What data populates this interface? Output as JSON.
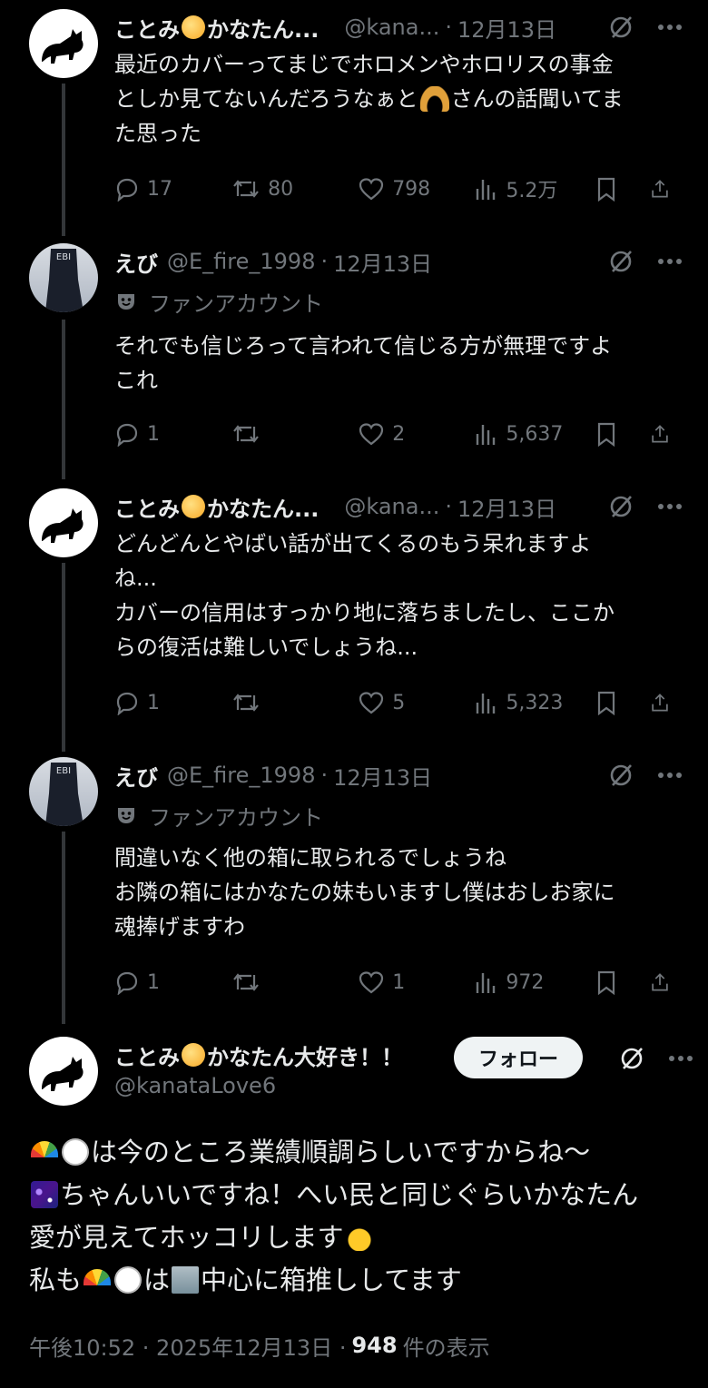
{
  "replies": [
    {
      "name": "ことみ",
      "name_after_emoji": "かなたん...",
      "handle": "@kana...",
      "dot": "·",
      "date": "12月13日",
      "text": "最近のカバーってまじでホロメンやホロリスの事金\nとしか見てないんだろうなぁと",
      "text_after_emoji": "さんの話聞いてま\nた思った",
      "reply_count": "17",
      "repost_count": "80",
      "like_count": "798",
      "view_count": "5.2万"
    },
    {
      "name": "えび",
      "handle": "@E_fire_1998",
      "dot": "·",
      "date": "12月13日",
      "label": "ファンアカウント",
      "text": "それでも信じろって言われて信じる方が無理ですよ\nこれ",
      "reply_count": "1",
      "repost_count": "",
      "like_count": "2",
      "view_count": "5,637"
    },
    {
      "name": "ことみ",
      "name_after_emoji": "かなたん...",
      "handle": "@kana...",
      "dot": "·",
      "date": "12月13日",
      "text": "どんどんとやばい話が出てくるのもう呆れますよ\nね...\nカバーの信用はすっかり地に落ちましたし、ここか\nらの復活は難しいでしょうね...",
      "reply_count": "1",
      "repost_count": "",
      "like_count": "5",
      "view_count": "5,323"
    },
    {
      "name": "えび",
      "handle": "@E_fire_1998",
      "dot": "·",
      "date": "12月13日",
      "label": "ファンアカウント",
      "text": "間違いなく他の箱に取られるでしょうね\nお隣の箱にはかなたの妹もいますし僕はおしお家に\n魂捧げますわ",
      "reply_count": "1",
      "repost_count": "",
      "like_count": "1",
      "view_count": "972"
    }
  ],
  "main": {
    "name": "ことみ",
    "name_after_emoji": "かなたん大好き！！",
    "handle": "@kanataLove6",
    "follow_label": "フォロー",
    "line1": "は今のところ業績順調らしいですからね〜",
    "line2": "ちゃんいいですね！へい民と同じぐらいかなたん",
    "line3": "愛が見えてホッコリします",
    "line4a": "私も",
    "line4b": "は",
    "line4c": "中心に箱推ししてます",
    "time": "午後10:52 · 2025年12月13日 ·",
    "view_count": "948",
    "view_label": "件の表示"
  },
  "colors": {
    "background": "#000000",
    "text": "#e7e9ea",
    "muted": "#71767b",
    "follow_bg": "#eff3f4"
  }
}
